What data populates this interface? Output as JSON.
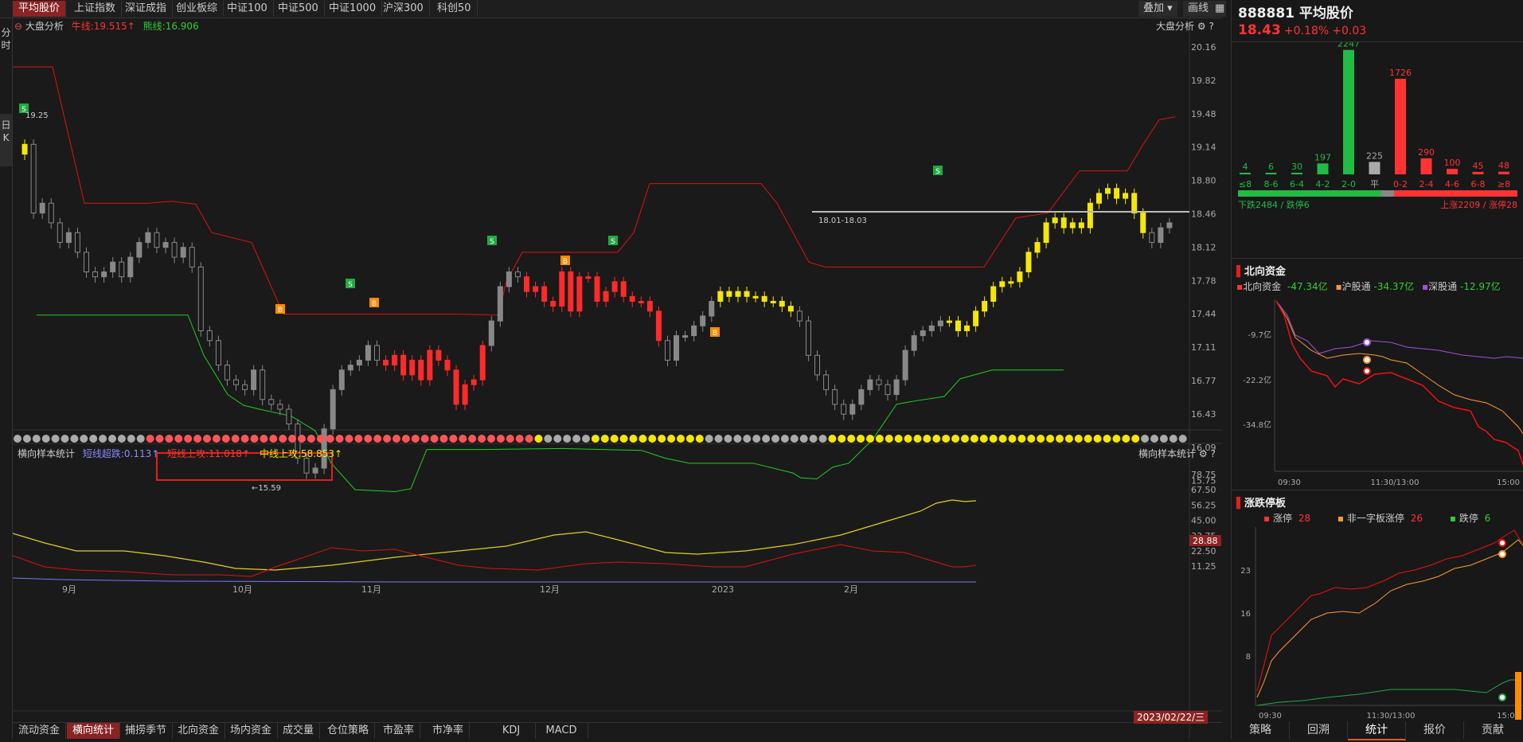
{
  "top_tabs": [
    "平均股价",
    "上证指数",
    "深证成指",
    "创业板综",
    "中证100",
    "中证500",
    "中证1000",
    "沪深300",
    "科创50"
  ],
  "top_right": {
    "overlay": "叠加",
    "draw": "画线"
  },
  "side_tabs": [
    {
      "l1": "分",
      "l2": "时"
    },
    {
      "l1": "日",
      "l2": "K"
    }
  ],
  "main_chart": {
    "indicator_name": "大盘分析",
    "long_line_label": "牛线:19.515",
    "bear_line_label": "熊线:16.906",
    "right_title": "大盘分析",
    "y_ticks": [
      "20.16",
      "19.82",
      "19.48",
      "19.14",
      "18.80",
      "18.46",
      "18.12",
      "17.78",
      "17.44",
      "17.11",
      "16.77",
      "16.43",
      "16.09",
      "15.75"
    ],
    "high_label": "19.25",
    "low_label": "15.59",
    "range_label": "18.01-18.03"
  },
  "sub_chart": {
    "name": "横向样本统计",
    "super_drop": "短线超跌:0.113",
    "short_up": "短线上攻:11.018",
    "mid_up": "中线上攻:58.853",
    "right_title": "横向样本统计",
    "y_ticks": [
      "78.75",
      "67.50",
      "56.25",
      "45.00",
      "33.75",
      "22.50",
      "11.25"
    ],
    "current_value": "28.88"
  },
  "x_labels": [
    "9月",
    "10月",
    "11月",
    "12月",
    "2023",
    "2月"
  ],
  "date_label": "2023/02/22/三",
  "bottom_tabs": [
    "流动资金",
    "横向统计",
    "捕捞季节",
    "北向资金",
    "场内资金",
    "成交量",
    "仓位策略",
    "市盈率",
    "市净率",
    "KDJ",
    "MACD"
  ],
  "quote": {
    "code": "888881",
    "name": "平均股价",
    "price": "18.43",
    "pct": "+0.18%",
    "chg": "+0.03"
  },
  "distribution": {
    "bins": [
      "≤8",
      "8-6",
      "6-4",
      "4-2",
      "2-0",
      "平",
      "0-2",
      "2-4",
      "4-6",
      "6-8",
      "≥8"
    ],
    "counts": [
      "4",
      "6",
      "30",
      "197",
      "2247",
      "225",
      "1726",
      "290",
      "100",
      "45",
      "48"
    ],
    "values": [
      4,
      6,
      30,
      197,
      2247,
      225,
      1726,
      290,
      100,
      45,
      48
    ],
    "down_label": "下跌2484 / 跌停6",
    "up_label": "上涨2209 / 涨停28"
  },
  "north": {
    "title": "北向资金",
    "total": "北向资金",
    "total_val": "-47.34亿",
    "sh": "沪股通",
    "sh_val": "-34.37亿",
    "sz": "深股通",
    "sz_val": "-12.97亿",
    "y_ticks": [
      "-9.7亿",
      "-22.2亿",
      "-34.8亿"
    ],
    "x_ticks": [
      "09:30",
      "11:30/13:00",
      "15:00"
    ]
  },
  "limit": {
    "title": "涨跌停板",
    "up": "涨停",
    "up_val": "28",
    "nonone": "非一字板涨停",
    "nonone_val": "26",
    "down": "跌停",
    "down_val": "6",
    "y_ticks": [
      "23",
      "16",
      "8"
    ],
    "x_ticks": [
      "09:30",
      "11:30/13:00",
      "15:00"
    ]
  },
  "panel_tabs": [
    "策略",
    "回溯",
    "统计",
    "报价",
    "贡献"
  ],
  "colors": {
    "up": "#ff3333",
    "down": "#22bb44",
    "yellow": "#f5e60a",
    "accent": "#8b2323"
  }
}
